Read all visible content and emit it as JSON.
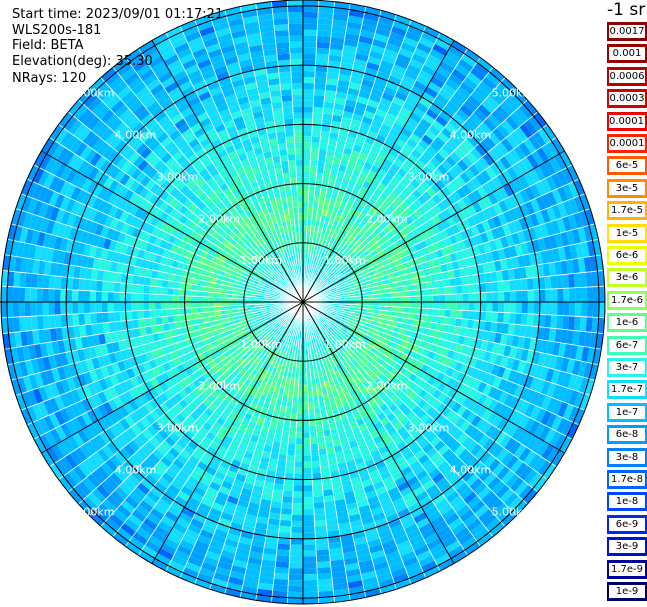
{
  "header": {
    "start_time": "Start time: 2023/09/01 01:17:21",
    "instrument": "WLS200s-181",
    "field": "Field: BETA",
    "elevation": "Elevation(deg): 35.30",
    "nrays": "NRays: 120"
  },
  "colorbar": {
    "unit": "-1 sr",
    "entries": [
      {
        "label": "0.0017",
        "color": "#8b0000"
      },
      {
        "label": "0.001",
        "color": "#9a0000"
      },
      {
        "label": "0.0006",
        "color": "#b40000"
      },
      {
        "label": "0.0003",
        "color": "#d40000"
      },
      {
        "label": "0.00017",
        "color": "#f00000"
      },
      {
        "label": "0.0001",
        "color": "#ff2400"
      },
      {
        "label": "6e-5",
        "color": "#ff5a00"
      },
      {
        "label": "3e-5",
        "color": "#ff8c00"
      },
      {
        "label": "1.7e-5",
        "color": "#ffb400"
      },
      {
        "label": "1e-5",
        "color": "#ffe000"
      },
      {
        "label": "6e-6",
        "color": "#f0ff00"
      },
      {
        "label": "3e-6",
        "color": "#c0ff28"
      },
      {
        "label": "1.7e-6",
        "color": "#8cff5a"
      },
      {
        "label": "1e-6",
        "color": "#5aff8c"
      },
      {
        "label": "6e-7",
        "color": "#3cffb4"
      },
      {
        "label": "3e-7",
        "color": "#28f5e6"
      },
      {
        "label": "1.7e-7",
        "color": "#14dcff"
      },
      {
        "label": "1e-7",
        "color": "#00beff"
      },
      {
        "label": "6e-8",
        "color": "#00a0ff"
      },
      {
        "label": "3e-8",
        "color": "#0082ff"
      },
      {
        "label": "1.7e-8",
        "color": "#0064ff"
      },
      {
        "label": "1e-8",
        "color": "#0046ff"
      },
      {
        "label": "6e-9",
        "color": "#0028f0"
      },
      {
        "label": "3e-9",
        "color": "#0014c8"
      },
      {
        "label": "1.7e-9",
        "color": "#00009a"
      },
      {
        "label": "1e-9",
        "color": "#000064"
      }
    ]
  },
  "chart_data": {
    "type": "heatmap",
    "projection": "polar PPI",
    "n_rays": 120,
    "range_rings_km": [
      1,
      2,
      3,
      4,
      5
    ],
    "max_range_km": 5.1,
    "azimuth_spokes_deg": [
      0,
      30,
      60,
      90,
      120,
      150,
      180,
      210,
      240,
      270,
      300,
      330
    ],
    "ring_labels": [
      "1.00km",
      "2.00km",
      "3.00km",
      "4.00km",
      "5.00km"
    ],
    "range_profile": [
      {
        "range_km": 0.5,
        "value": 3e-07
      },
      {
        "range_km": 1.0,
        "value": 6e-07
      },
      {
        "range_km": 1.5,
        "value": 1e-06
      },
      {
        "range_km": 2.0,
        "value": 6e-07
      },
      {
        "range_km": 3.0,
        "value": 3e-07
      },
      {
        "range_km": 4.0,
        "value": 1.7e-07
      },
      {
        "range_km": 5.0,
        "value": 1e-07
      }
    ]
  }
}
